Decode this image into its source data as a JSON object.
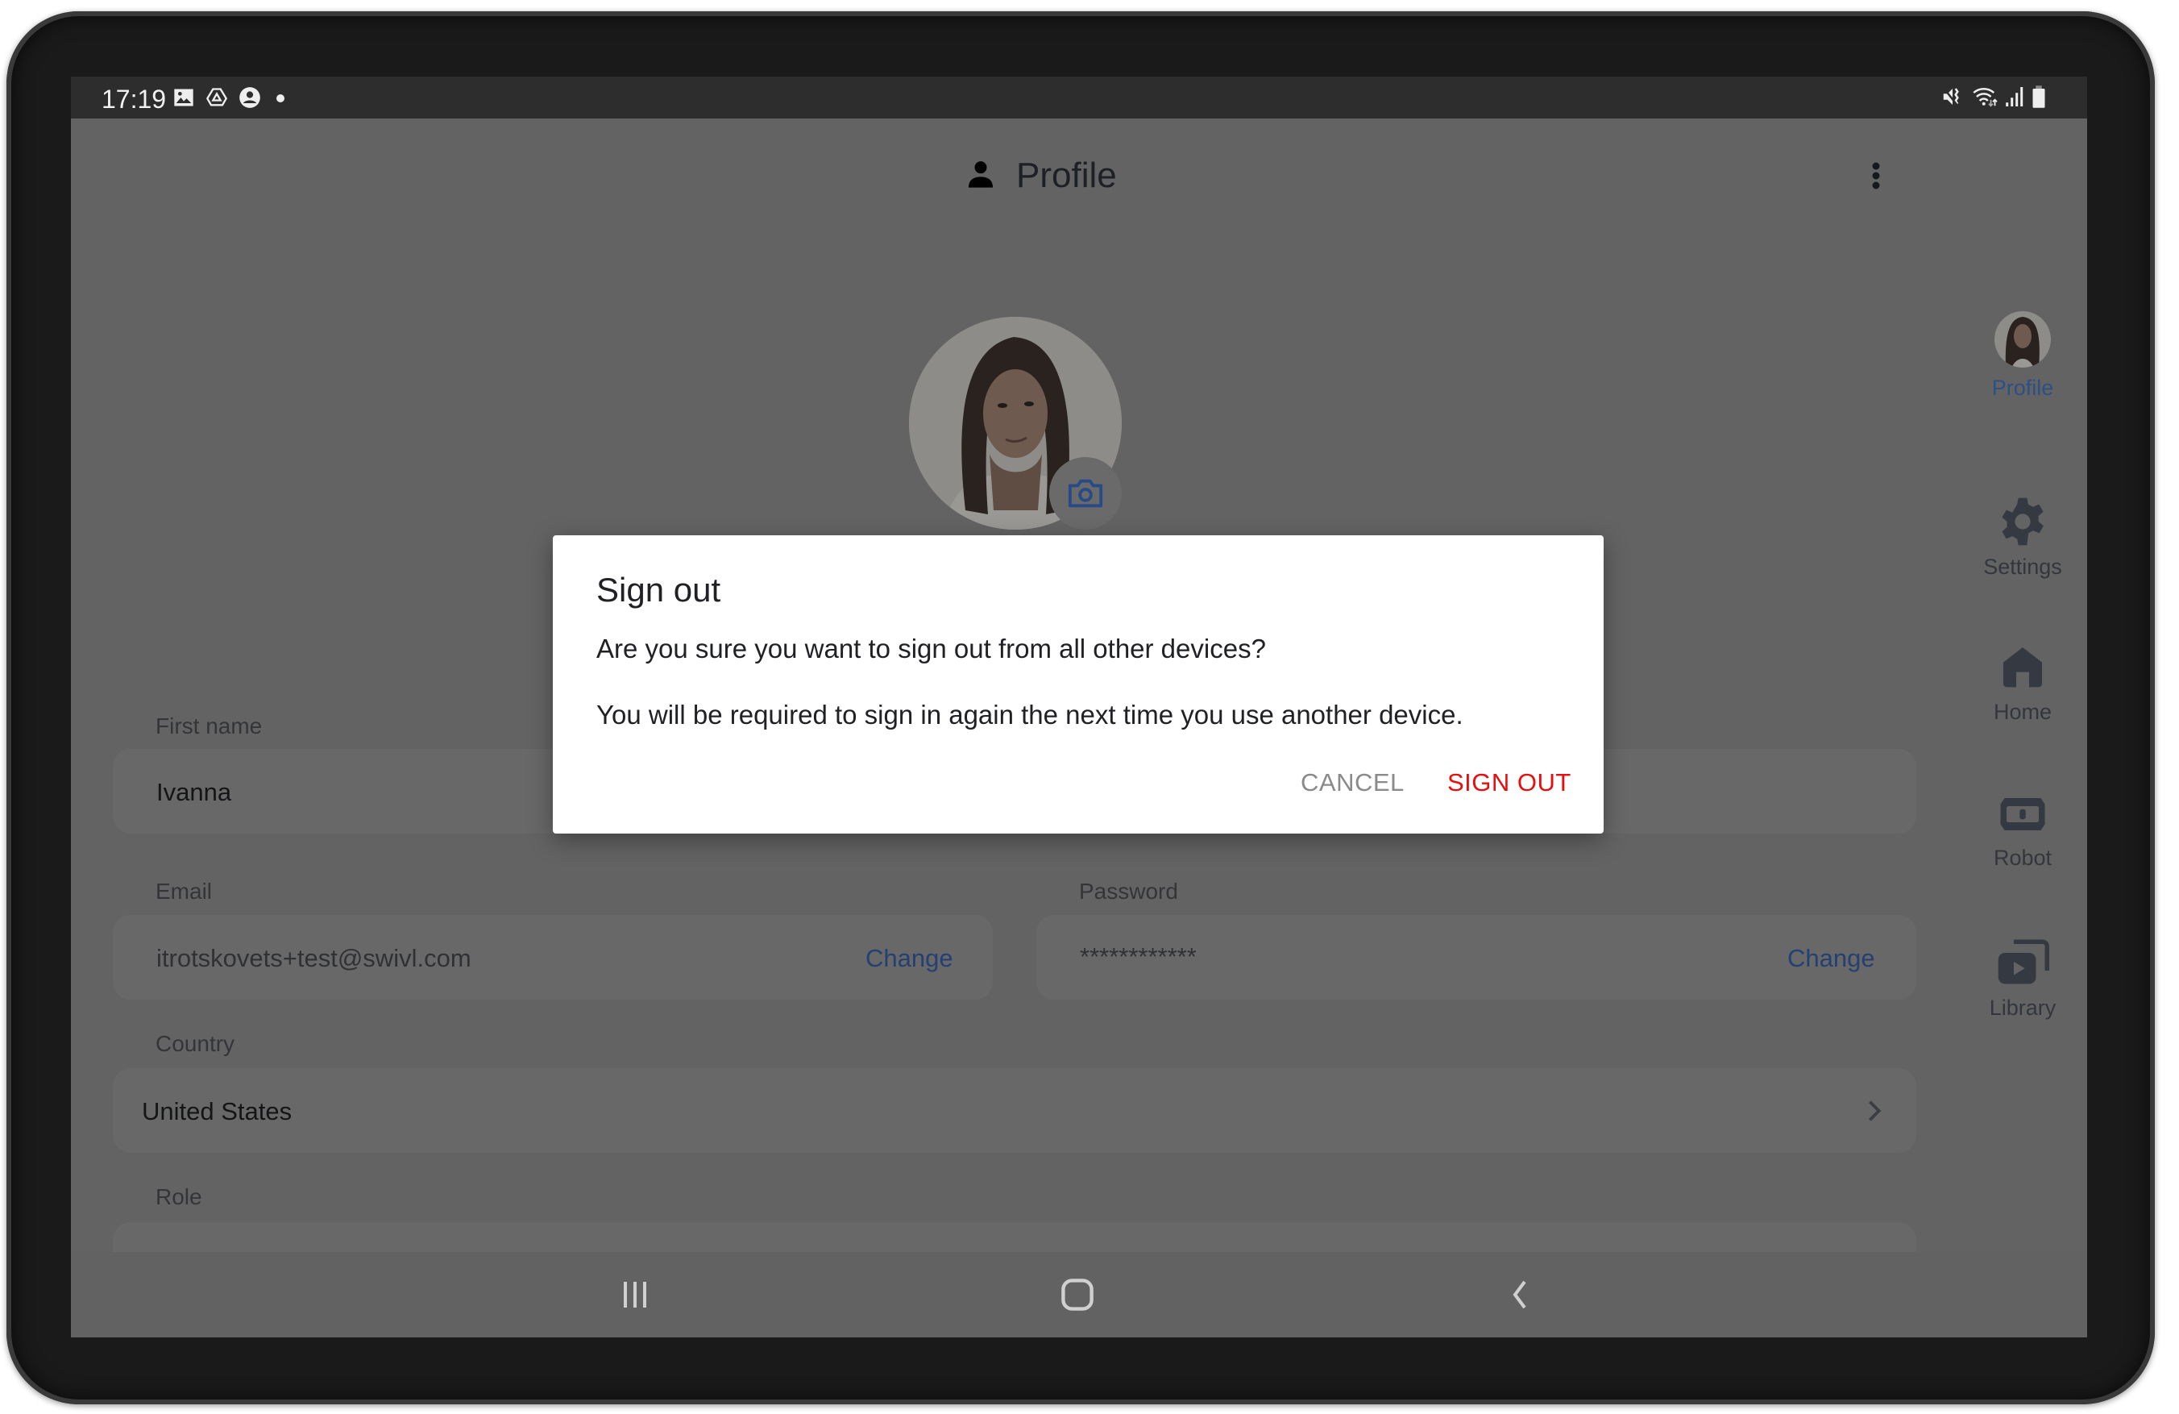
{
  "status_bar": {
    "time": "17:19",
    "left_icons": [
      "gallery-icon",
      "drive-icon",
      "account-icon",
      "dot-icon"
    ],
    "right_icons": [
      "mute-icon",
      "wifi-icon",
      "signal-icon",
      "battery-icon"
    ]
  },
  "header": {
    "title": "Profile",
    "icon": "person-icon",
    "menu_icon": "more-vert-icon"
  },
  "profile": {
    "avatar_alt": "Profile photo",
    "camera_icon": "camera-icon"
  },
  "form": {
    "first_name": {
      "label": "First name",
      "value": "Ivanna"
    },
    "email": {
      "label": "Email",
      "value": "itrotskovets+test@swivl.com",
      "action": "Change"
    },
    "password": {
      "label": "Password",
      "value": "************",
      "action": "Change"
    },
    "country": {
      "label": "Country",
      "value": "United States"
    },
    "role": {
      "label": "Role",
      "value": ""
    }
  },
  "rail": {
    "items": [
      {
        "label": "Profile",
        "icon": "avatar-icon",
        "active": true
      },
      {
        "label": "Settings",
        "icon": "gear-icon",
        "active": false
      },
      {
        "label": "Home",
        "icon": "home-icon",
        "active": false
      },
      {
        "label": "Robot",
        "icon": "robot-icon",
        "active": false
      },
      {
        "label": "Library",
        "icon": "library-icon",
        "active": false
      }
    ]
  },
  "dialog": {
    "title": "Sign out",
    "message_1": "Are you sure you want to sign out from all other devices?",
    "message_2": "You will be required to sign in again the next time you use another device.",
    "cancel_label": "CANCEL",
    "confirm_label": "SIGN OUT"
  },
  "nav_bar": {
    "buttons": [
      "recents-icon",
      "home-button-icon",
      "back-icon"
    ]
  },
  "colors": {
    "accent": "#2c4f86",
    "danger": "#e60f0f",
    "scrim": "#636363",
    "status_bar": "#2d2d2d"
  }
}
